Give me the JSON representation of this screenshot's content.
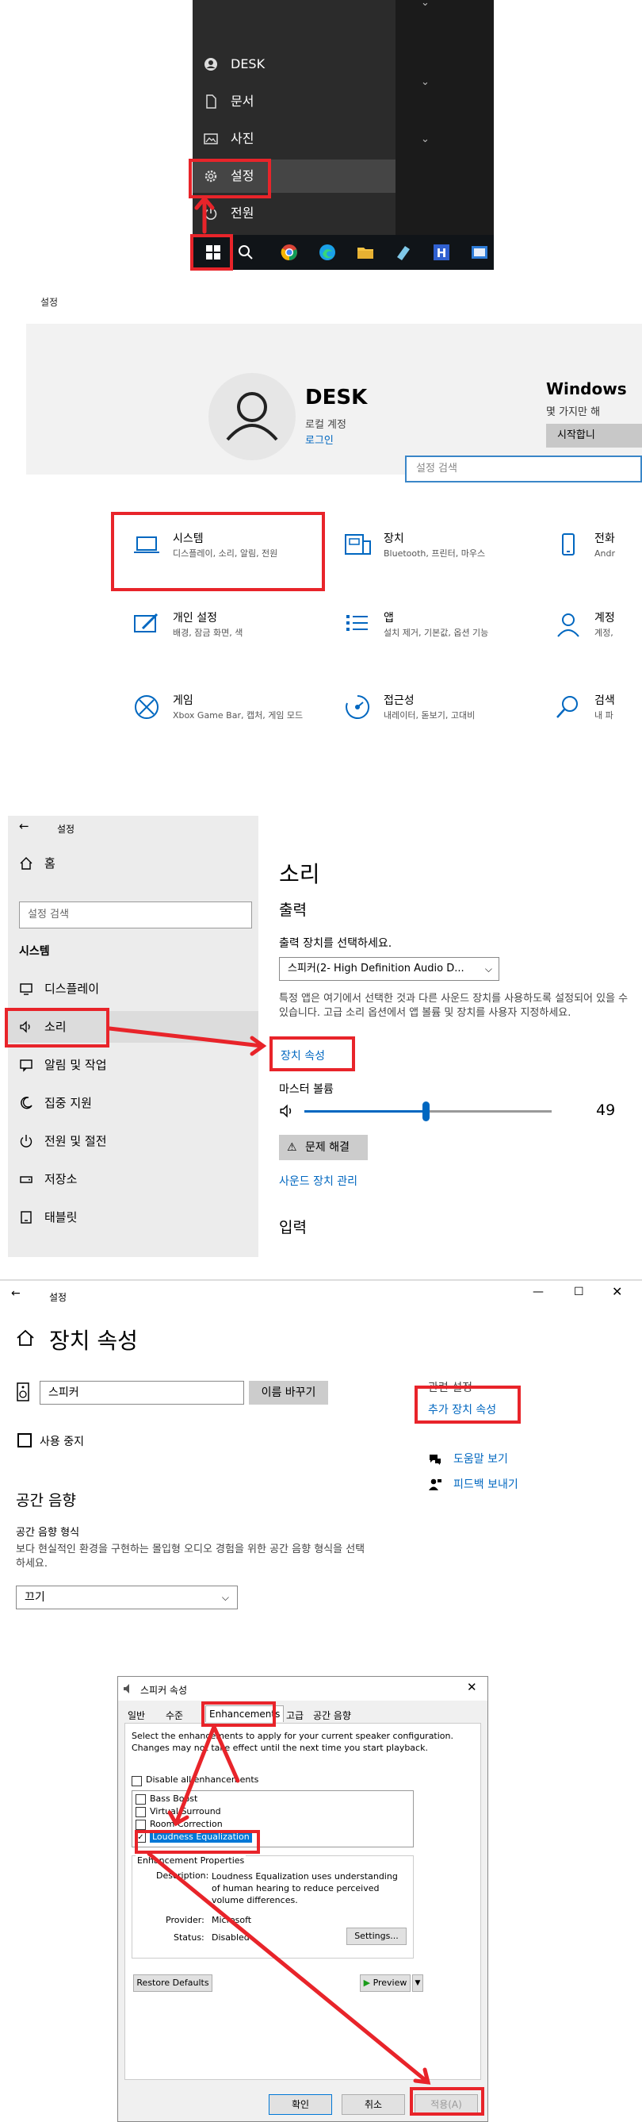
{
  "start_menu": {
    "items": [
      {
        "label": "DESK",
        "icon": "user-icon"
      },
      {
        "label": "문서",
        "icon": "document-icon"
      },
      {
        "label": "사진",
        "icon": "picture-icon"
      },
      {
        "label": "설정",
        "icon": "gear-icon"
      },
      {
        "label": "전원",
        "icon": "power-icon"
      }
    ]
  },
  "settings_home": {
    "title": "설정",
    "user_name": "DESK",
    "account_type": "로컬 계정",
    "login_link": "로그인",
    "windows_title": "Windows",
    "windows_desc": "몇 가지만 해",
    "start_button": "시작합니",
    "search_placeholder": "설정 검색",
    "categories": [
      {
        "title": "시스템",
        "desc": "디스플레이, 소리, 알림, 전원"
      },
      {
        "title": "장치",
        "desc": "Bluetooth, 프린터, 마우스"
      },
      {
        "title": "전화",
        "desc": "Andr"
      },
      {
        "title": "개인 설정",
        "desc": "배경, 잠금 화면, 색"
      },
      {
        "title": "앱",
        "desc": "설치 제거, 기본값, 옵션 기능"
      },
      {
        "title": "계정",
        "desc": "계정,"
      },
      {
        "title": "게임",
        "desc": "Xbox Game Bar, 캡처, 게임 모드"
      },
      {
        "title": "접근성",
        "desc": "내레이터, 돋보기, 고대비"
      },
      {
        "title": "검색",
        "desc": "내 파"
      }
    ]
  },
  "sound": {
    "window_title": "설정",
    "home": "홈",
    "search_placeholder": "설정 검색",
    "section": "시스템",
    "nav": [
      "디스플레이",
      "소리",
      "알림 및 작업",
      "집중 지원",
      "전원 및 절전",
      "저장소",
      "태블릿"
    ],
    "page_title": "소리",
    "output_heading": "출력",
    "choose_device": "출력 장치를 선택하세요.",
    "device_value": "스피커(2- High Definition Audio D...",
    "info_text": "특정 앱은 여기에서 선택한 것과 다른 사운드 장치를 사용하도록 설정되어 있을 수 있습니다. 고급 소리 옵션에서 앱 볼륨 및 장치를 사용자 지정하세요.",
    "device_properties_link": "장치 속성",
    "master_volume_label": "마스터 볼륨",
    "volume": 49,
    "volume_text": "49",
    "troubleshoot": "문제 해결",
    "manage_devices": "사운드 장치 관리",
    "input_heading": "입력"
  },
  "device_props": {
    "window_title": "설정",
    "page_title": "장치 속성",
    "name_value": "스피커",
    "rename_button": "이름 바꾸기",
    "disable_label": "사용 중지",
    "spatial_heading": "공간 음향",
    "spatial_format_label": "공간 음향 형식",
    "spatial_desc": "보다 현실적인 환경을 구현하는 몰입형 오디오 경험을 위한 공간 음향 형식을 선택하세요.",
    "spatial_value": "끄기",
    "related_heading": "관련 설정",
    "additional_link": "추가 장치 속성",
    "help_link": "도움말 보기",
    "feedback_link": "피드백 보내기"
  },
  "dialog": {
    "title": "스피커 속성",
    "tabs": [
      "일반",
      "수준",
      "Enhancements",
      "고급",
      "공간 음향"
    ],
    "instructions": "Select the enhancements to apply for your current speaker configuration. Changes may not take effect until the next time you start playback.",
    "disable_all": "Disable all enhancements",
    "enhancements": [
      "Bass Boost",
      "Virtual Surround",
      "Room Correction",
      "Loudness Equalization"
    ],
    "properties_heading": "Enhancement Properties",
    "description_label": "Description:",
    "description_text": "Loudness Equalization uses understanding of human hearing to reduce perceived volume differences.",
    "provider_label": "Provider:",
    "provider_value": "Microsoft",
    "status_label": "Status:",
    "status_value": "Disabled",
    "settings_button": "Settings...",
    "restore_button": "Restore Defaults",
    "preview_button": "Preview",
    "ok": "확인",
    "cancel": "취소",
    "apply": "적용(A)"
  },
  "colors": {
    "accent": "#0067c0",
    "annotation": "#e8242a",
    "start_bg": "#2b2b2b"
  }
}
